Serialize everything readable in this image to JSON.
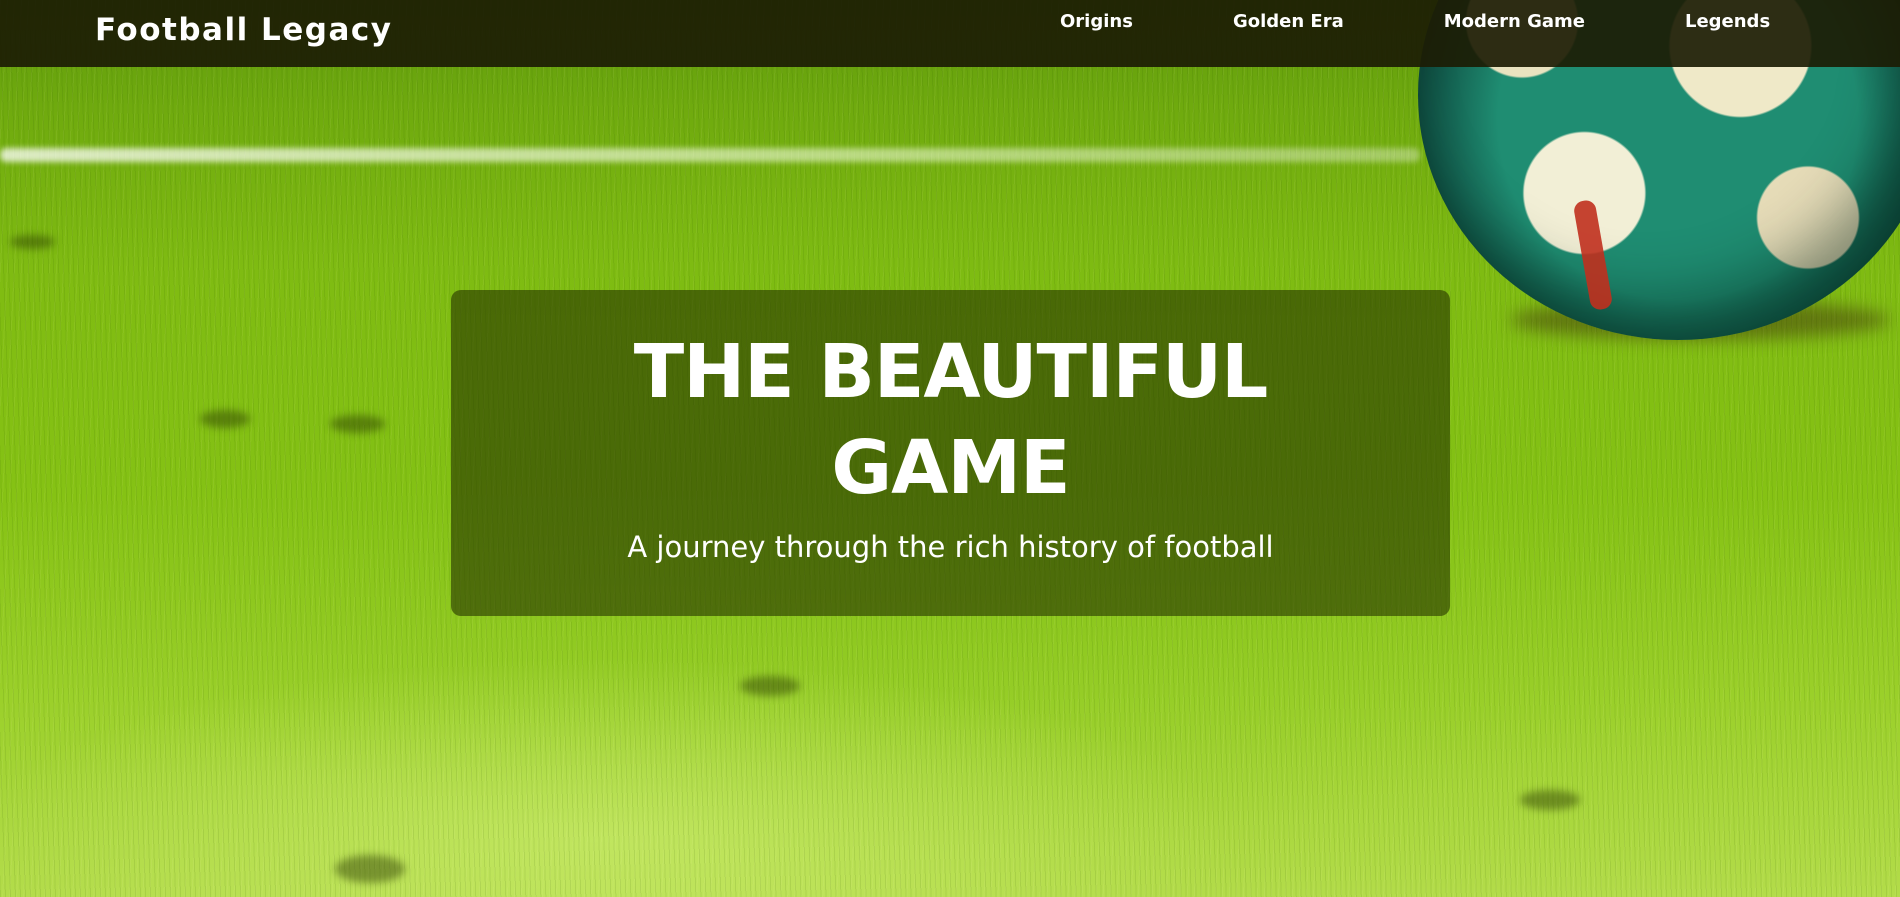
{
  "header": {
    "logo": "Football Legacy",
    "nav": [
      {
        "label": "Origins"
      },
      {
        "label": "Golden Era"
      },
      {
        "label": "Modern Game"
      },
      {
        "label": "Legends"
      }
    ]
  },
  "hero": {
    "title_line1": "THE BEAUTIFUL",
    "title_line2": "GAME",
    "subtitle": "A journey through the rich history of football"
  },
  "background": {
    "image": "grass-field-with-football",
    "colors": {
      "grass": "#7fbb12",
      "navbar": "#1c1c04",
      "overlay": "#283700"
    }
  }
}
